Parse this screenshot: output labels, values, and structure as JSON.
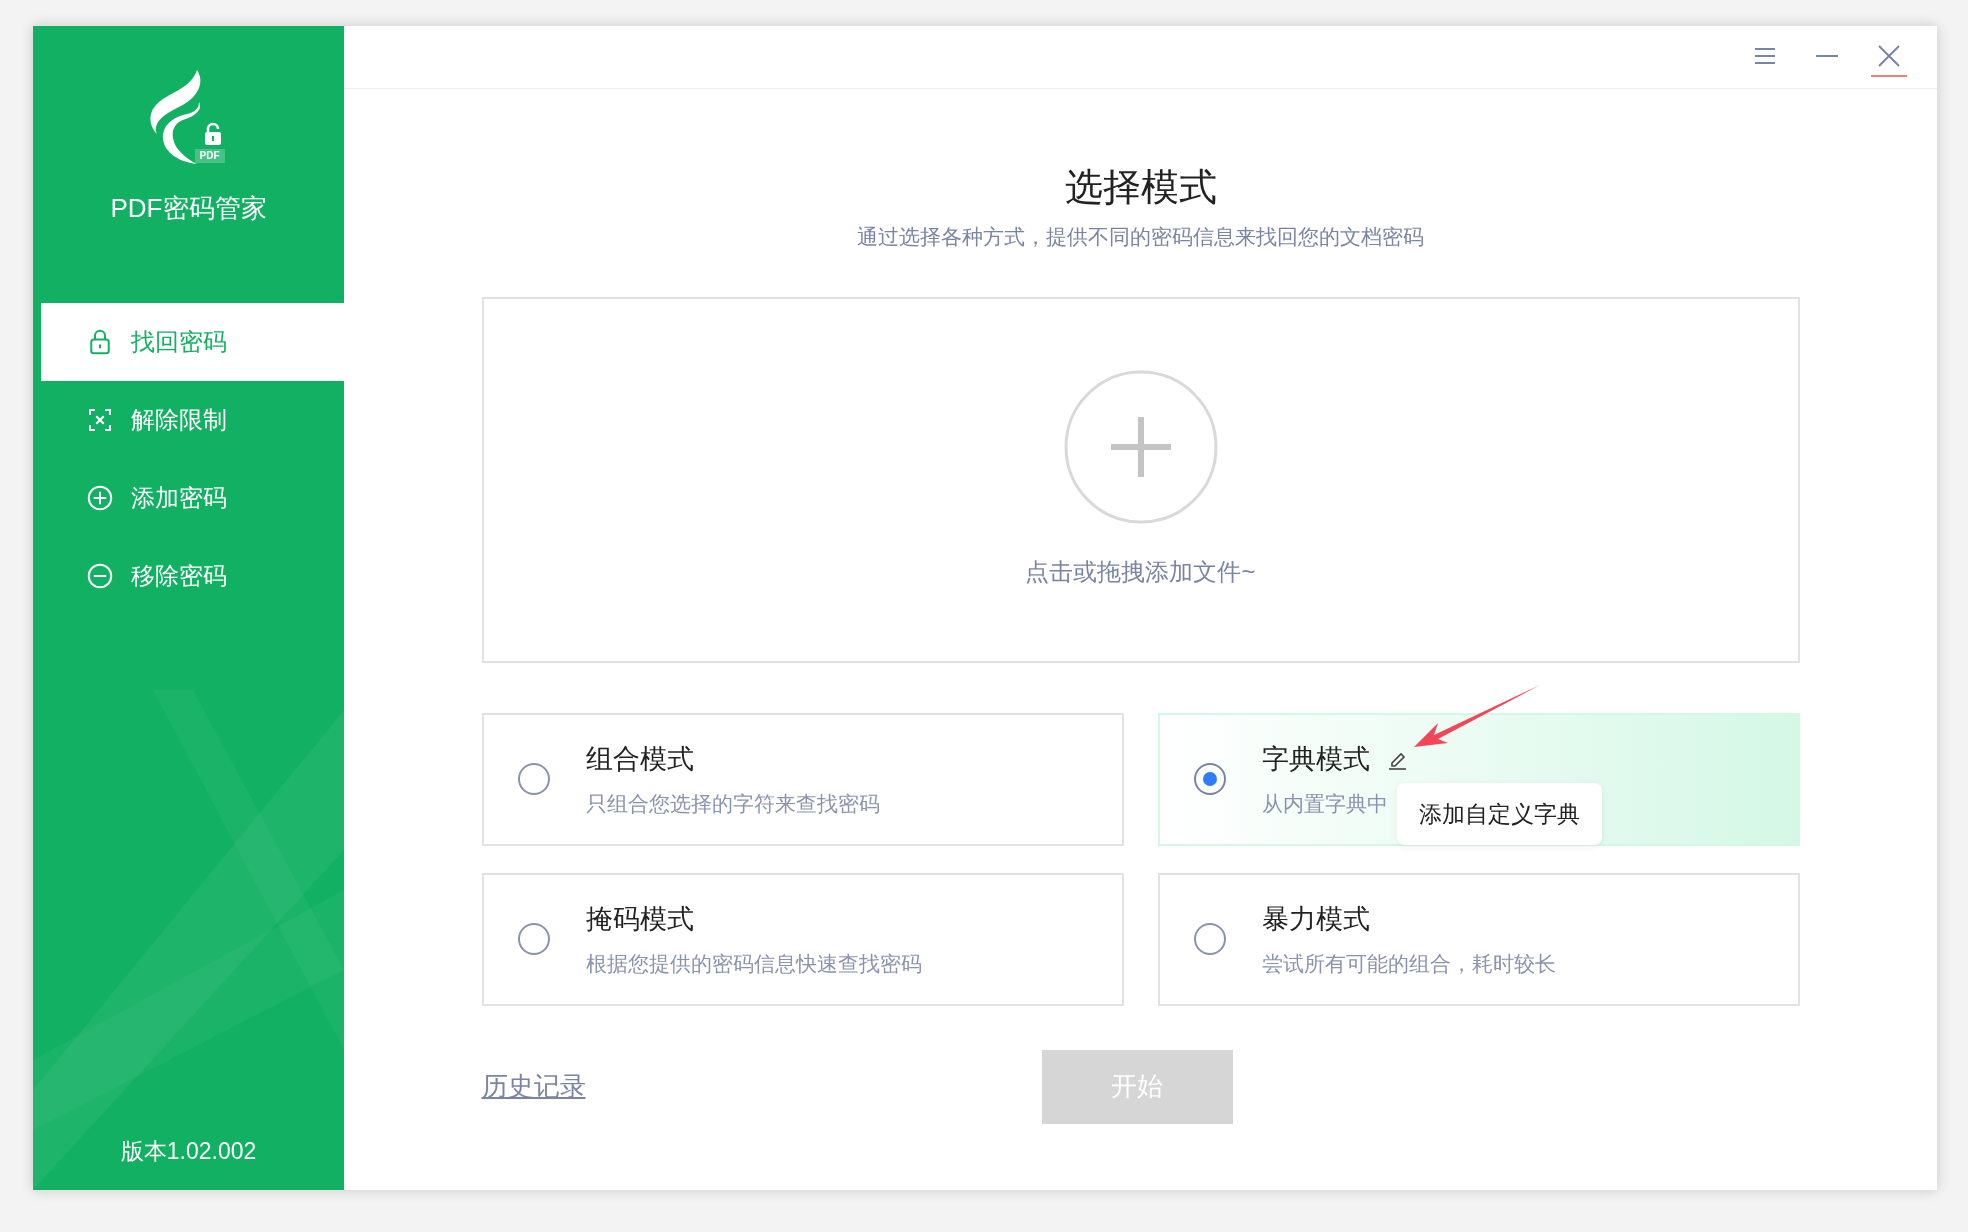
{
  "app": {
    "logo_badge": "PDF",
    "name": "PDF密码管家",
    "version": "版本1.02.002"
  },
  "window_controls": [
    {
      "kind": "menu",
      "hovered": false
    },
    {
      "kind": "minimize",
      "hovered": false
    },
    {
      "kind": "close",
      "hovered": true
    }
  ],
  "sidebar": {
    "items": [
      {
        "label": "找回密码",
        "kind": "lock",
        "selected": true
      },
      {
        "label": "解除限制",
        "kind": "unlock-frame",
        "selected": false
      },
      {
        "label": "添加密码",
        "kind": "plus",
        "selected": false
      },
      {
        "label": "移除密码",
        "kind": "minus",
        "selected": false
      }
    ]
  },
  "header": {
    "title": "选择模式",
    "subtitle": "通过选择各种方式，提供不同的密码信息来找回您的文档密码"
  },
  "dropzone": {
    "hint": "点击或拖拽添加文件~"
  },
  "modes": [
    {
      "title": "组合模式",
      "description": "只组合您选择的字符来查找密码",
      "selected": false,
      "editable": false
    },
    {
      "title": "字典模式",
      "description": "从内置字典中",
      "selected": true,
      "editable": true
    },
    {
      "title": "掩码模式",
      "description": "根据您提供的密码信息快速查找密码",
      "selected": false,
      "editable": false
    },
    {
      "title": "暴力模式",
      "description": "尝试所有可能的组合，耗时较长",
      "selected": false,
      "editable": false
    }
  ],
  "tooltip": {
    "text": "添加自定义字典"
  },
  "history_link": "历史记录",
  "start_button": {
    "label": "开始",
    "disabled": true
  }
}
